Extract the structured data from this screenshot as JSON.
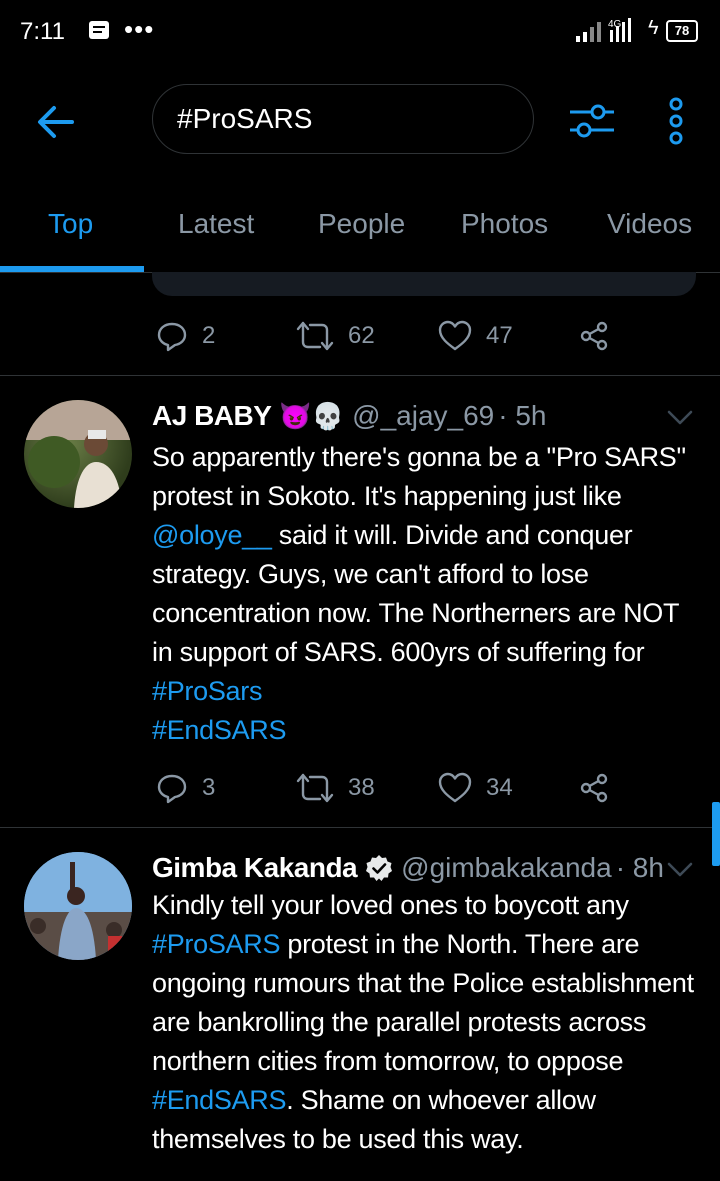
{
  "status_bar": {
    "time": "7:11",
    "network": "4G",
    "battery": "78"
  },
  "search": {
    "query": "#ProSARS"
  },
  "tabs": [
    "Top",
    "Latest",
    "People",
    "Photos",
    "Videos"
  ],
  "colors": {
    "accent": "#1d9bf0",
    "background": "#000000",
    "muted": "#8b98a5",
    "divider": "#2f3336"
  },
  "icons": [
    "back-arrow-icon",
    "filter-icon",
    "more-vertical-icon",
    "reply-icon",
    "retweet-icon",
    "like-icon",
    "share-icon",
    "chevron-down-icon",
    "verified-icon"
  ],
  "previous_tweet": {
    "replies": "2",
    "retweets": "62",
    "likes": "47"
  },
  "tweets": [
    {
      "name": "AJ BABY",
      "emoji": "😈💀",
      "handle": "@_ajay_69",
      "time": "· 5h",
      "text_parts": {
        "p1": "So apparently there's gonna be a \"Pro SARS\" protest in Sokoto. It's happening just like ",
        "mention": "@oloye__",
        "p2": " said it will. Divide and conquer strategy. Guys, we can't afford to lose concentration now. The Northerners are NOT in support of SARS. 600yrs of suffering for",
        "tag1": "#ProSars",
        "tag2": "#EndSARS"
      },
      "replies": "3",
      "retweets": "38",
      "likes": "34"
    },
    {
      "name": "Gimba Kakanda",
      "verified": true,
      "handle": "@gimbakakanda",
      "time": "· 8h",
      "text_parts": {
        "p1": "Kindly tell your loved ones to boycott any ",
        "tag1": "#ProSARS",
        "p2": " protest in the North. There are ongoing rumours that the Police establishment are bankrolling the parallel protests across northern cities from tomorrow, to oppose ",
        "tag2": "#EndSARS",
        "p3": ". Shame on whoever allow themselves to be used this way."
      }
    }
  ]
}
